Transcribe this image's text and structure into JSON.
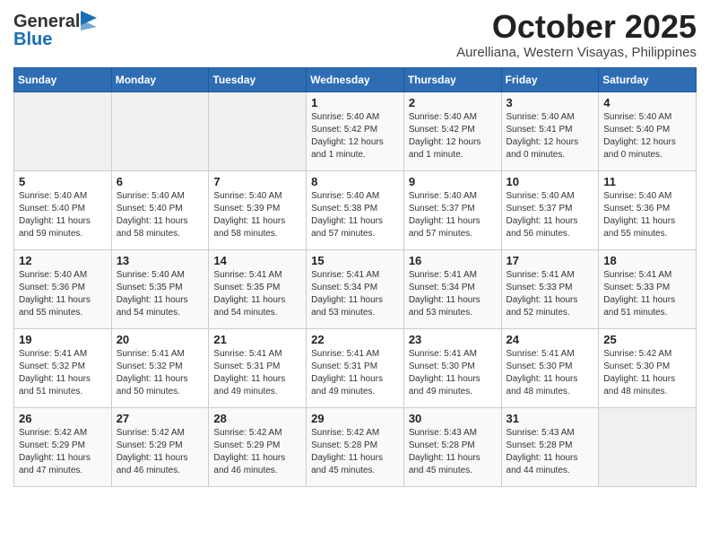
{
  "logo": {
    "text_general": "General",
    "text_blue": "Blue"
  },
  "header": {
    "month": "October 2025",
    "location": "Aurelliana, Western Visayas, Philippines"
  },
  "weekdays": [
    "Sunday",
    "Monday",
    "Tuesday",
    "Wednesday",
    "Thursday",
    "Friday",
    "Saturday"
  ],
  "weeks": [
    [
      {
        "day": "",
        "empty": true
      },
      {
        "day": "",
        "empty": true
      },
      {
        "day": "",
        "empty": true
      },
      {
        "day": "1",
        "sunrise": "5:40 AM",
        "sunset": "5:42 PM",
        "daylight": "12 hours and 1 minute."
      },
      {
        "day": "2",
        "sunrise": "5:40 AM",
        "sunset": "5:42 PM",
        "daylight": "12 hours and 1 minute."
      },
      {
        "day": "3",
        "sunrise": "5:40 AM",
        "sunset": "5:41 PM",
        "daylight": "12 hours and 0 minutes."
      },
      {
        "day": "4",
        "sunrise": "5:40 AM",
        "sunset": "5:40 PM",
        "daylight": "12 hours and 0 minutes."
      }
    ],
    [
      {
        "day": "5",
        "sunrise": "5:40 AM",
        "sunset": "5:40 PM",
        "daylight": "11 hours and 59 minutes."
      },
      {
        "day": "6",
        "sunrise": "5:40 AM",
        "sunset": "5:40 PM",
        "daylight": "11 hours and 58 minutes."
      },
      {
        "day": "7",
        "sunrise": "5:40 AM",
        "sunset": "5:39 PM",
        "daylight": "11 hours and 58 minutes."
      },
      {
        "day": "8",
        "sunrise": "5:40 AM",
        "sunset": "5:38 PM",
        "daylight": "11 hours and 57 minutes."
      },
      {
        "day": "9",
        "sunrise": "5:40 AM",
        "sunset": "5:37 PM",
        "daylight": "11 hours and 57 minutes."
      },
      {
        "day": "10",
        "sunrise": "5:40 AM",
        "sunset": "5:37 PM",
        "daylight": "11 hours and 56 minutes."
      },
      {
        "day": "11",
        "sunrise": "5:40 AM",
        "sunset": "5:36 PM",
        "daylight": "11 hours and 55 minutes."
      }
    ],
    [
      {
        "day": "12",
        "sunrise": "5:40 AM",
        "sunset": "5:36 PM",
        "daylight": "11 hours and 55 minutes."
      },
      {
        "day": "13",
        "sunrise": "5:40 AM",
        "sunset": "5:35 PM",
        "daylight": "11 hours and 54 minutes."
      },
      {
        "day": "14",
        "sunrise": "5:41 AM",
        "sunset": "5:35 PM",
        "daylight": "11 hours and 54 minutes."
      },
      {
        "day": "15",
        "sunrise": "5:41 AM",
        "sunset": "5:34 PM",
        "daylight": "11 hours and 53 minutes."
      },
      {
        "day": "16",
        "sunrise": "5:41 AM",
        "sunset": "5:34 PM",
        "daylight": "11 hours and 53 minutes."
      },
      {
        "day": "17",
        "sunrise": "5:41 AM",
        "sunset": "5:33 PM",
        "daylight": "11 hours and 52 minutes."
      },
      {
        "day": "18",
        "sunrise": "5:41 AM",
        "sunset": "5:33 PM",
        "daylight": "11 hours and 51 minutes."
      }
    ],
    [
      {
        "day": "19",
        "sunrise": "5:41 AM",
        "sunset": "5:32 PM",
        "daylight": "11 hours and 51 minutes."
      },
      {
        "day": "20",
        "sunrise": "5:41 AM",
        "sunset": "5:32 PM",
        "daylight": "11 hours and 50 minutes."
      },
      {
        "day": "21",
        "sunrise": "5:41 AM",
        "sunset": "5:31 PM",
        "daylight": "11 hours and 49 minutes."
      },
      {
        "day": "22",
        "sunrise": "5:41 AM",
        "sunset": "5:31 PM",
        "daylight": "11 hours and 49 minutes."
      },
      {
        "day": "23",
        "sunrise": "5:41 AM",
        "sunset": "5:30 PM",
        "daylight": "11 hours and 49 minutes."
      },
      {
        "day": "24",
        "sunrise": "5:41 AM",
        "sunset": "5:30 PM",
        "daylight": "11 hours and 48 minutes."
      },
      {
        "day": "25",
        "sunrise": "5:42 AM",
        "sunset": "5:30 PM",
        "daylight": "11 hours and 48 minutes."
      }
    ],
    [
      {
        "day": "26",
        "sunrise": "5:42 AM",
        "sunset": "5:29 PM",
        "daylight": "11 hours and 47 minutes."
      },
      {
        "day": "27",
        "sunrise": "5:42 AM",
        "sunset": "5:29 PM",
        "daylight": "11 hours and 46 minutes."
      },
      {
        "day": "28",
        "sunrise": "5:42 AM",
        "sunset": "5:29 PM",
        "daylight": "11 hours and 46 minutes."
      },
      {
        "day": "29",
        "sunrise": "5:42 AM",
        "sunset": "5:28 PM",
        "daylight": "11 hours and 45 minutes."
      },
      {
        "day": "30",
        "sunrise": "5:43 AM",
        "sunset": "5:28 PM",
        "daylight": "11 hours and 45 minutes."
      },
      {
        "day": "31",
        "sunrise": "5:43 AM",
        "sunset": "5:28 PM",
        "daylight": "11 hours and 44 minutes."
      },
      {
        "day": "",
        "empty": true
      }
    ]
  ],
  "labels": {
    "sunrise": "Sunrise: ",
    "sunset": "Sunset: ",
    "daylight": "Daylight hours"
  }
}
